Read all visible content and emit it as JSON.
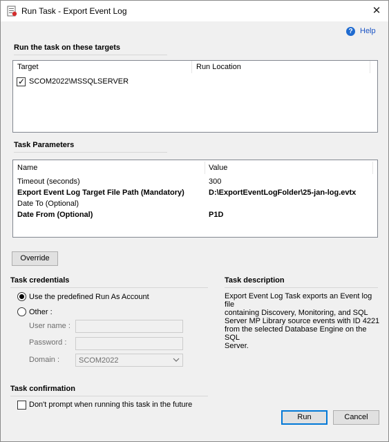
{
  "window": {
    "title": "Run Task - Export Event Log",
    "close_glyph": "✕"
  },
  "help": {
    "label": "Help",
    "icon_glyph": "?"
  },
  "targets": {
    "title": "Run the task on these targets",
    "columns": [
      "Target",
      "Run Location"
    ],
    "rows": [
      {
        "checked": true,
        "target": "SCOM2022\\MSSQLSERVER",
        "run_location": ""
      }
    ]
  },
  "parameters": {
    "title": "Task Parameters",
    "columns": [
      "Name",
      "Value"
    ],
    "rows": [
      {
        "name": "Timeout (seconds)",
        "value": "300",
        "bold": false
      },
      {
        "name": "Export Event Log Target File Path (Mandatory)",
        "value": "D:\\ExportEventLogFolder\\25-jan-log.evtx",
        "bold": true
      },
      {
        "name": "Date To (Optional)",
        "value": "",
        "bold": false
      },
      {
        "name": "Date From (Optional)",
        "value": "P1D",
        "bold": true
      }
    ]
  },
  "override_button": "Override",
  "credentials": {
    "title": "Task credentials",
    "option_predefined": "Use the predefined Run As Account",
    "option_other": "Other :",
    "selected": "predefined",
    "username_label": "User name :",
    "username_value": "",
    "password_label": "Password :",
    "password_value": "",
    "domain_label": "Domain :",
    "domain_value": "SCOM2022"
  },
  "description": {
    "title": "Task description",
    "lines": [
      "Export Event Log Task exports an Event log file",
      "containing Discovery, Monitoring, and SQL",
      "Server MP Library source events with ID 4221",
      "from the selected Database Engine on the SQL",
      "Server."
    ]
  },
  "confirmation": {
    "title": "Task confirmation",
    "checkbox_label": "Don't prompt when running this task in the future",
    "checked": false
  },
  "buttons": {
    "run": "Run",
    "cancel": "Cancel"
  }
}
